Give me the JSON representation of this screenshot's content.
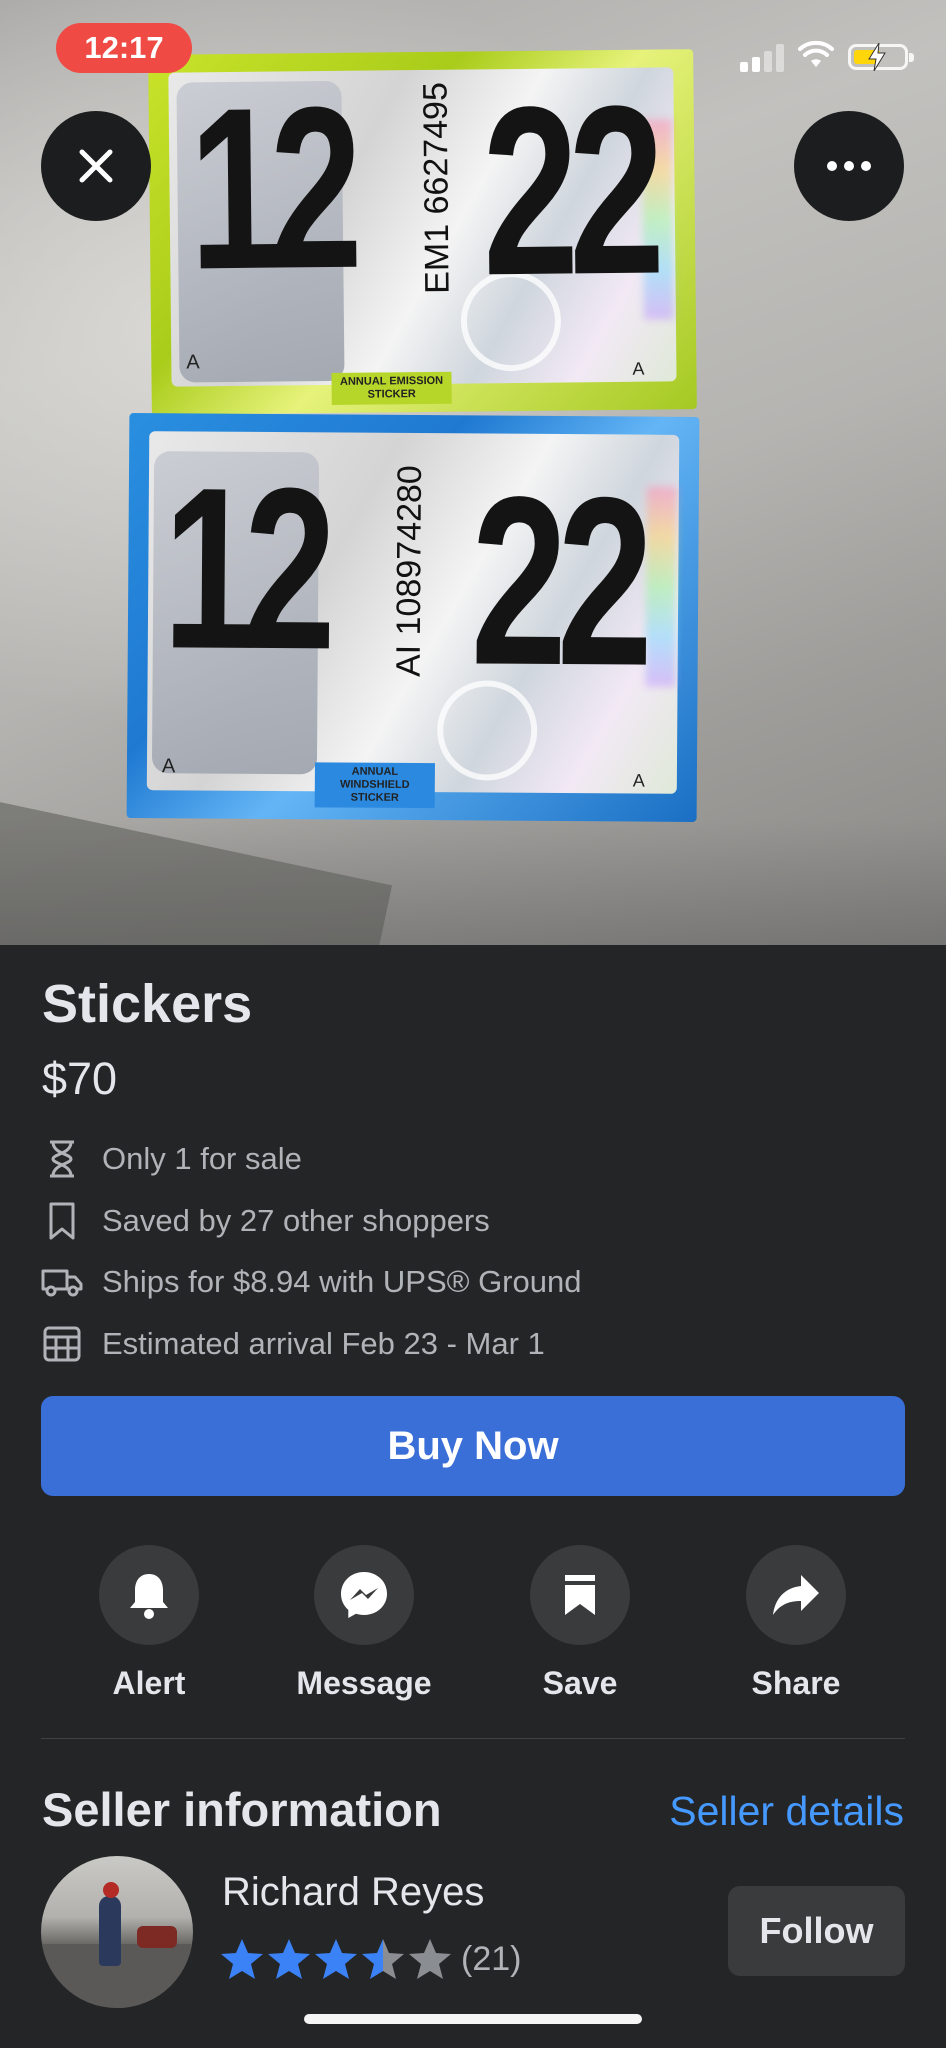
{
  "status_bar": {
    "time": "12:17"
  },
  "photo": {
    "top_sticker": {
      "month": "12",
      "year": "22",
      "serial": "EM1 6627495",
      "caption": "ANNUAL EMISSION STICKER",
      "letter": "A"
    },
    "bottom_sticker": {
      "month": "12",
      "year": "22",
      "serial": "AI 108974280",
      "caption": "ANNUAL WINDSHIELD STICKER",
      "letter": "A"
    }
  },
  "listing": {
    "title": "Stickers",
    "price": "$70",
    "details": [
      {
        "icon": "hourglass-icon",
        "text": "Only 1 for sale"
      },
      {
        "icon": "bookmark-icon",
        "text": "Saved by 27 other shoppers"
      },
      {
        "icon": "truck-icon",
        "text": "Ships for $8.94 with UPS® Ground"
      },
      {
        "icon": "calendar-icon",
        "text": "Estimated arrival Feb 23 - Mar 1"
      }
    ],
    "buy_label": "Buy Now"
  },
  "actions": [
    {
      "icon": "bell-icon",
      "label": "Alert"
    },
    {
      "icon": "messenger-icon",
      "label": "Message"
    },
    {
      "icon": "bookmark-icon",
      "label": "Save"
    },
    {
      "icon": "share-arrow-icon",
      "label": "Share"
    }
  ],
  "seller": {
    "section_title": "Seller information",
    "details_link": "Seller details",
    "name": "Richard Reyes",
    "rating": 3.5,
    "rating_count": "(21)",
    "follow_label": "Follow"
  },
  "colors": {
    "primary_button": "#3a6fd8",
    "link": "#4599ff",
    "star_active": "#3b82f6",
    "star_inactive": "#8a8d91",
    "background": "#242526"
  }
}
